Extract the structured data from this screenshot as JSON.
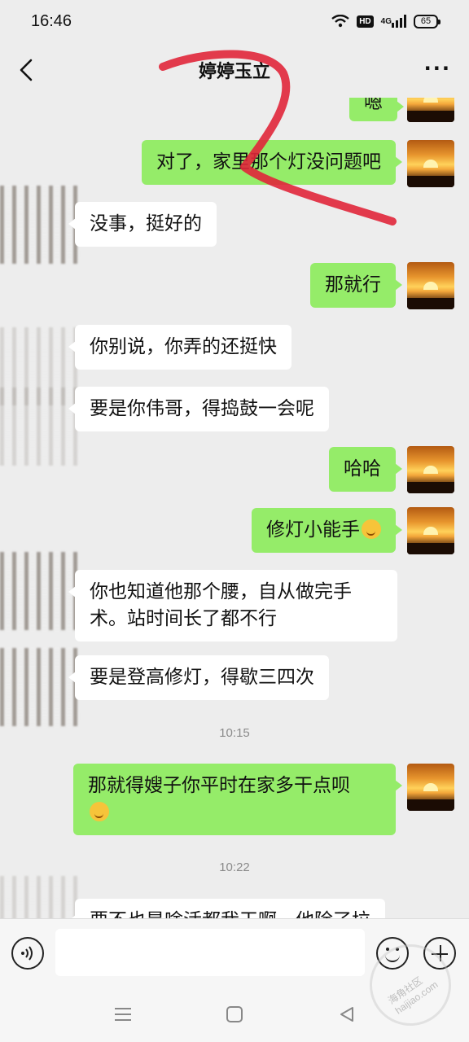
{
  "status_bar": {
    "time": "16:46",
    "hd_label": "HD",
    "network_label": "4G",
    "battery": "65"
  },
  "header": {
    "title": "婷婷玉立",
    "more_label": "···"
  },
  "messages": [
    {
      "side": "out",
      "text": "嗯"
    },
    {
      "side": "out",
      "text": "对了，家里那个灯没问题吧"
    },
    {
      "side": "in",
      "text": "没事，挺好的"
    },
    {
      "side": "out",
      "text": "那就行"
    },
    {
      "side": "in",
      "text": "你别说，你弄的还挺快"
    },
    {
      "side": "in",
      "text": "要是你伟哥，得捣鼓一会呢"
    },
    {
      "side": "out",
      "text": "哈哈"
    },
    {
      "side": "out",
      "text": "修灯小能手"
    },
    {
      "side": "in",
      "text": "你也知道他那个腰，自从做完手术。站时间长了都不行"
    },
    {
      "side": "in",
      "text": "要是登高修灯，得歇三四次"
    },
    {
      "side": "out",
      "text": "那就得嫂子你平时在家多干点呗"
    },
    {
      "side": "in",
      "text": "要不也是啥活都我干啊，他除了垃"
    }
  ],
  "timestamps": [
    "10:15",
    "10:22"
  ],
  "icons": {
    "back": "chevron-left-icon",
    "more": "more-dots-icon",
    "voice": "voice-icon",
    "emoji": "emoji-icon",
    "plus": "plus-icon",
    "menu": "menu-icon",
    "home": "home-icon",
    "back_nav": "back-triangle-icon"
  },
  "colors": {
    "outgoing_bubble": "#95ec69",
    "incoming_bubble": "#ffffff",
    "background": "#ededed",
    "annotation_red": "#e0263a"
  },
  "watermark": {
    "text": "海角社区 haijiao.com"
  }
}
